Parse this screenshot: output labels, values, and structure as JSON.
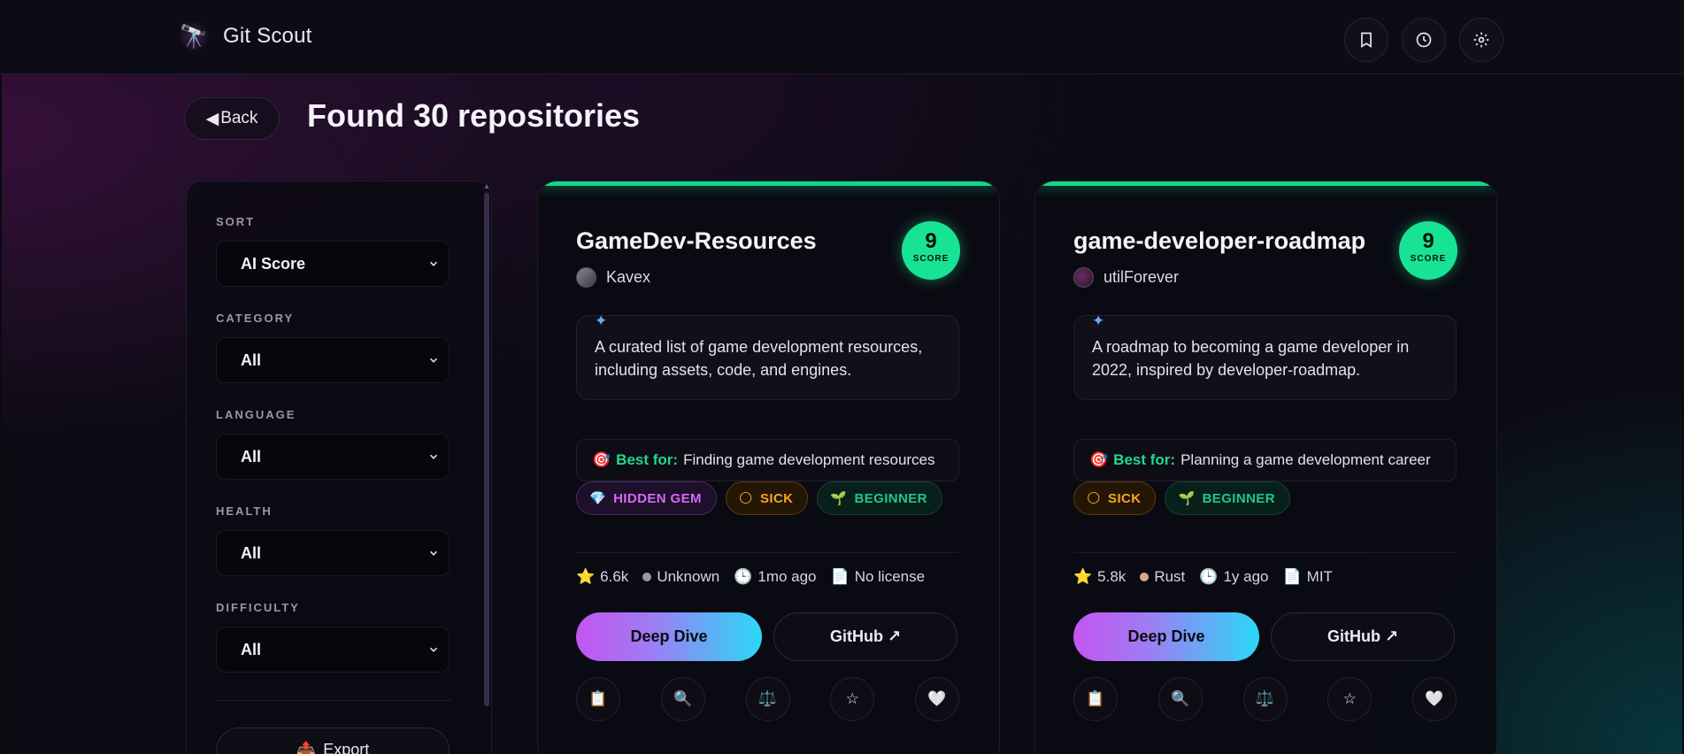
{
  "app": {
    "name": "Git Scout",
    "logo_icon": "telescope-icon"
  },
  "header": {
    "buttons": [
      {
        "name": "bookmarks-button",
        "icon": "bookmark-icon"
      },
      {
        "name": "history-button",
        "icon": "clock-icon"
      },
      {
        "name": "settings-button",
        "icon": "gear-icon"
      }
    ]
  },
  "toolbar": {
    "back_label": "Back",
    "back_glyph": "◀",
    "title": "Found 30 repositories"
  },
  "filters": {
    "sort": {
      "label": "SORT",
      "value": "AI Score"
    },
    "category": {
      "label": "CATEGORY",
      "value": "All"
    },
    "language": {
      "label": "LANGUAGE",
      "value": "All"
    },
    "health": {
      "label": "HEALTH",
      "value": "All"
    },
    "difficulty": {
      "label": "DIFFICULTY",
      "value": "All"
    },
    "export_label": "Export",
    "export_glyph": "📤"
  },
  "cards": [
    {
      "title": "GameDev-Resources",
      "owner": "Kavex",
      "score": "9",
      "score_label": "SCORE",
      "summary": "A curated list of game development resources, including assets, code, and engines.",
      "best_for_label": "Best for:",
      "best_for": "Finding game development resources",
      "tags": [
        "HIDDEN GEM",
        "SICK",
        "BEGINNER"
      ],
      "stars": "6.6k",
      "language": "Unknown",
      "language_color": "#9a98a3",
      "updated": "1mo ago",
      "license": "No license",
      "deep_dive_label": "Deep Dive",
      "github_label": "GitHub ↗"
    },
    {
      "title": "game-developer-roadmap",
      "owner": "utilForever",
      "score": "9",
      "score_label": "SCORE",
      "summary": "A roadmap to becoming a game developer in 2022, inspired by developer-roadmap.",
      "best_for_label": "Best for:",
      "best_for": "Planning a game development career",
      "tags": [
        "SICK",
        "BEGINNER"
      ],
      "stars": "5.8k",
      "language": "Rust",
      "language_color": "#dea584",
      "updated": "1y ago",
      "license": "MIT",
      "deep_dive_label": "Deep Dive",
      "github_label": "GitHub ↗"
    }
  ],
  "tag_glyphs": {
    "gem": "💎",
    "sick": "🌕",
    "beginner": "🌱"
  },
  "meta_glyphs": {
    "star": "⭐",
    "clock": "🕒",
    "file": "📄"
  },
  "action_icons": [
    "📋",
    "🔍",
    "⚖️",
    "☆",
    "🤍"
  ],
  "bestfor_glyph": "🎯",
  "sparkle_glyph": "✦"
}
